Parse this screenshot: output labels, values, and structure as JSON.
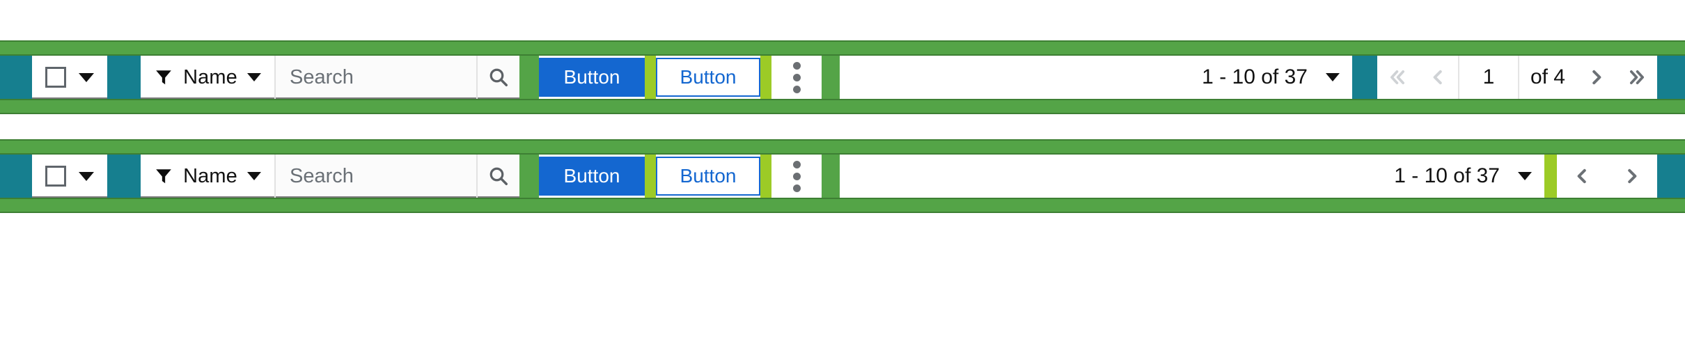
{
  "theme": {
    "band_green": "#54a447",
    "band_green_border": "#3d7f33",
    "teal": "#167f8f",
    "lime": "#9ccb26",
    "primary_blue": "#1467d0",
    "text_dark": "#111111",
    "placeholder_gray": "#6a7076",
    "disabled_gray": "#cfd2d5",
    "enabled_gray": "#6b7075"
  },
  "toolbars": [
    {
      "id": "toolbar-primary",
      "select_all": {
        "checked": false,
        "menu_caret": "chevron-down-icon"
      },
      "filter": {
        "icon": "filter-icon",
        "label": "Name",
        "caret": "chevron-down-icon"
      },
      "search": {
        "value": "",
        "placeholder": "Search",
        "button_icon": "search-icon"
      },
      "actions": [
        {
          "label": "Button",
          "style": "filled"
        },
        {
          "label": "Button",
          "style": "outline"
        }
      ],
      "overflow_menu": {
        "icon": "kebab-menu-icon"
      },
      "paginator": {
        "range_start": "1 - 10",
        "range_sep": "of",
        "range_total": "37",
        "range_text": "1 - 10 of 37",
        "page_size_caret": "chevron-down-icon",
        "first_page": {
          "icon": "double-chevron-left-icon",
          "disabled": true
        },
        "prev_page": {
          "icon": "chevron-left-icon",
          "disabled": true
        },
        "page_number": "1",
        "page_of_label": "of 4",
        "next_page": {
          "icon": "chevron-right-icon",
          "disabled": false
        },
        "last_page": {
          "icon": "double-chevron-right-icon",
          "disabled": false
        }
      }
    },
    {
      "id": "toolbar-secondary",
      "select_all": {
        "checked": false,
        "menu_caret": "chevron-down-icon"
      },
      "filter": {
        "icon": "filter-icon",
        "label": "Name",
        "caret": "chevron-down-icon"
      },
      "search": {
        "value": "",
        "placeholder": "Search",
        "button_icon": "search-icon"
      },
      "actions": [
        {
          "label": "Button",
          "style": "filled"
        },
        {
          "label": "Button",
          "style": "outline"
        }
      ],
      "overflow_menu": {
        "icon": "kebab-menu-icon"
      },
      "paginator": {
        "range_start": "1 - 10",
        "range_sep": "of",
        "range_total": "37",
        "range_text": "1 - 10 of 37",
        "page_size_caret": "chevron-down-icon",
        "prev_page": {
          "icon": "chevron-left-icon",
          "disabled": false
        },
        "next_page": {
          "icon": "chevron-right-icon",
          "disabled": false
        }
      }
    }
  ]
}
